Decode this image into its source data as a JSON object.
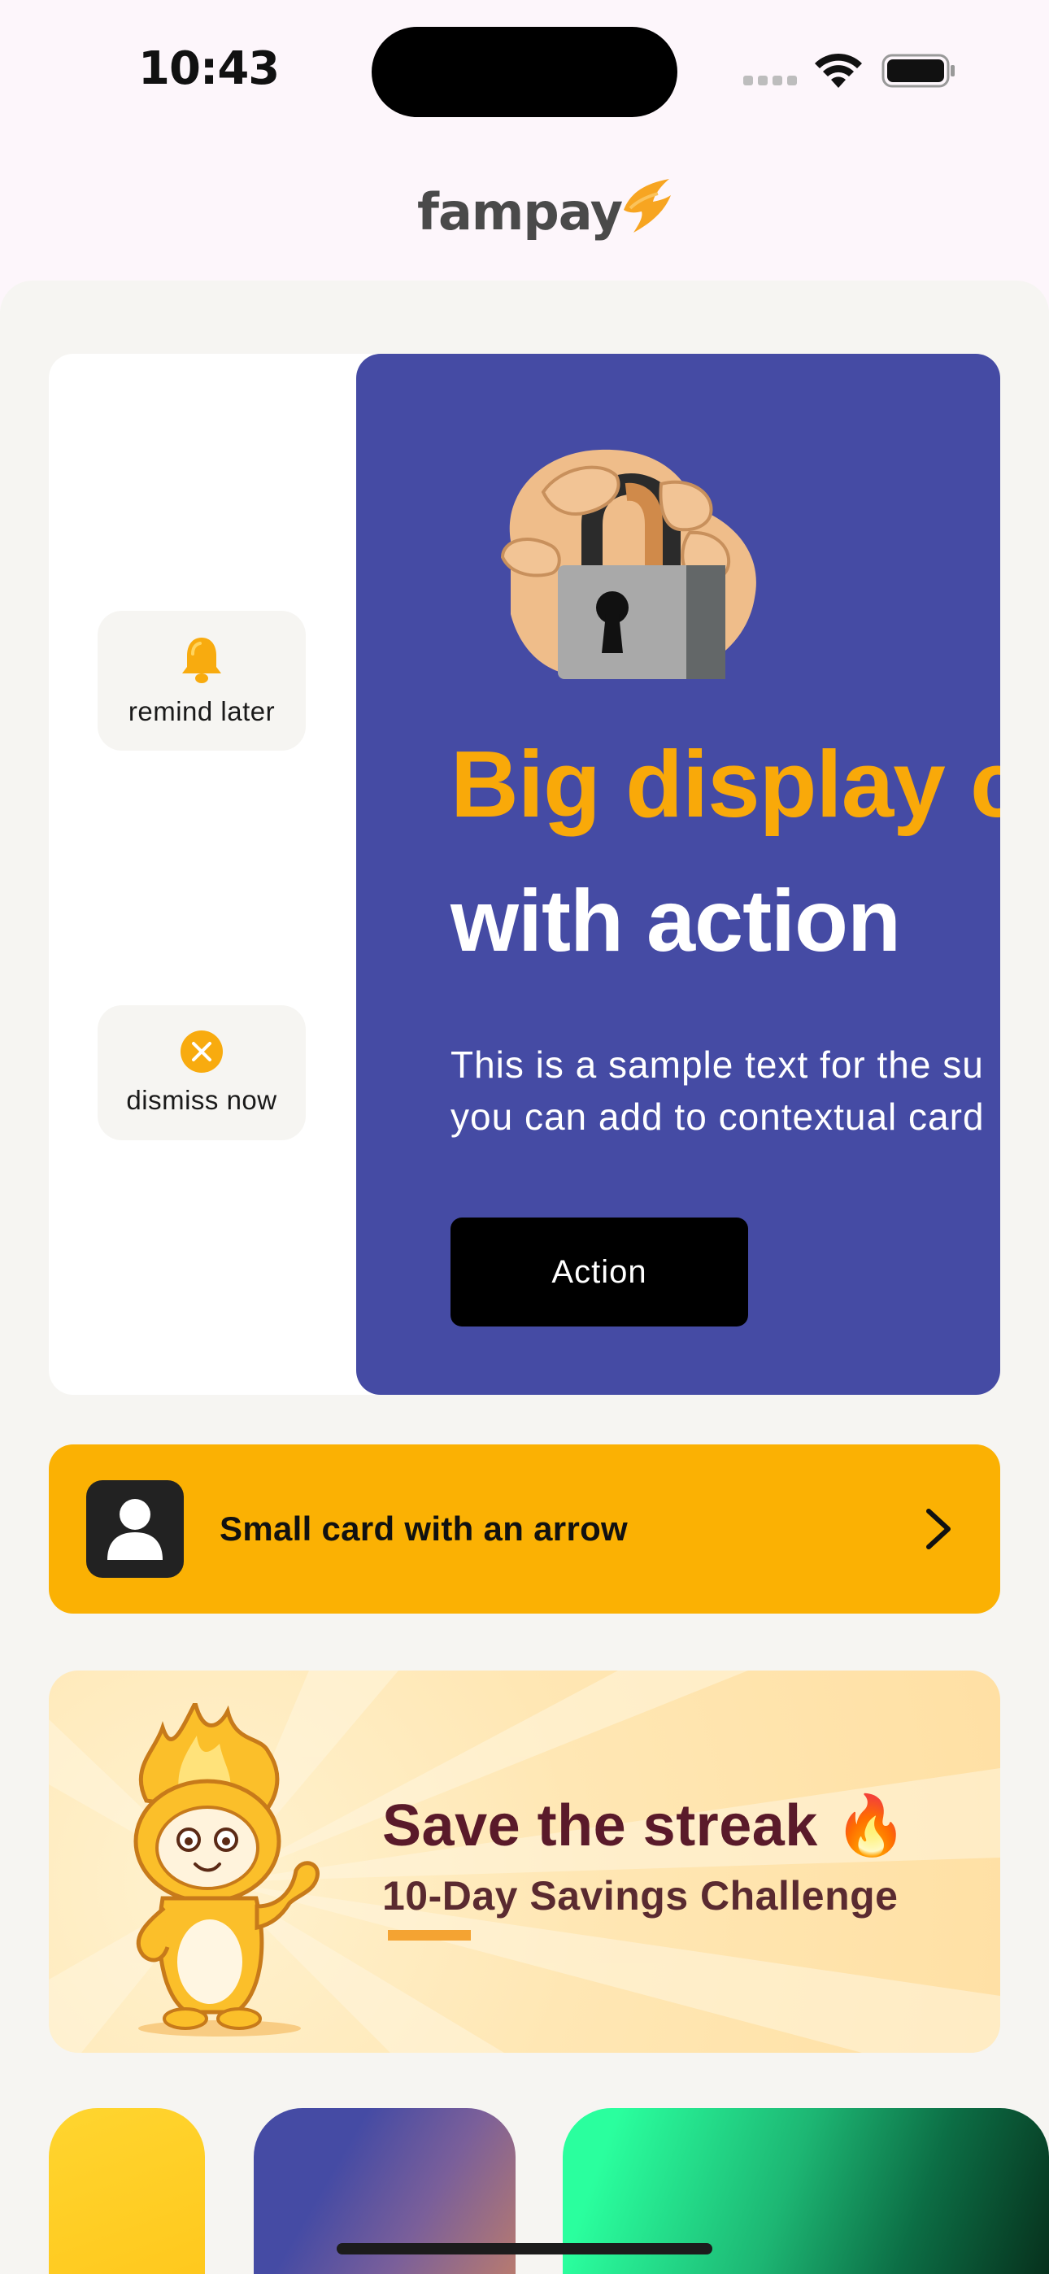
{
  "status_bar": {
    "time": "10:43"
  },
  "header": {
    "logo_text": "fampay"
  },
  "big_display_card": {
    "swipe_actions": [
      {
        "label": "remind later",
        "icon": "bell-icon"
      },
      {
        "label": "dismiss now",
        "icon": "dismiss-icon"
      }
    ],
    "title_highlight": "Big display c",
    "title_rest": "with action",
    "description_line1": "This is a sample text for the su",
    "description_line2": "you can add to contextual card",
    "action_label": "Action"
  },
  "small_card": {
    "title": "Small card with an arrow",
    "icon": "user-icon",
    "arrow": "chevron-right-icon"
  },
  "streak_banner": {
    "headline": "Save the streak",
    "emoji": "🔥",
    "subtitle": "10-Day Savings Challenge"
  },
  "colors": {
    "card_purple": "#454ba4",
    "accent_yellow": "#fbb103",
    "title_orange": "#f9a909"
  }
}
